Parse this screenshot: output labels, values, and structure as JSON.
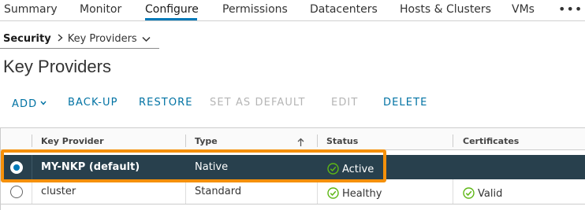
{
  "tabs": [
    {
      "label": "Summary"
    },
    {
      "label": "Monitor"
    },
    {
      "label": "Configure"
    },
    {
      "label": "Permissions"
    },
    {
      "label": "Datacenters"
    },
    {
      "label": "Hosts & Clusters"
    },
    {
      "label": "VMs"
    }
  ],
  "active_tab": "Configure",
  "more_label": "•••",
  "breadcrumb": {
    "root": "Security",
    "current": "Key Providers"
  },
  "page_title": "Key Providers",
  "toolbar": {
    "add": "ADD",
    "backup": "BACK-UP",
    "restore": "RESTORE",
    "set_default": "SET AS DEFAULT",
    "edit": "EDIT",
    "delete": "DELETE"
  },
  "grid": {
    "columns": [
      "Key Provider",
      "Type",
      "Status",
      "Certificates"
    ],
    "sorted_column": "Type",
    "sort_direction": "ascending",
    "rows": [
      {
        "key_provider": "MY-NKP (default)",
        "type": "Native",
        "status": "Active",
        "certificates": "",
        "selected": true
      },
      {
        "key_provider": "cluster",
        "type": "Standard",
        "status": "Healthy",
        "certificates": "Valid",
        "selected": false
      }
    ]
  },
  "colors": {
    "accent": "#0079b8",
    "link": "#0072a3",
    "selected_row": "#28404d",
    "status_ok": "#5eb715",
    "highlight": "#f5900a",
    "disabled": "#b5b5b5"
  },
  "icons": {
    "status": "check-circle-icon",
    "sort": "arrow-up-icon",
    "more": "ellipsis-icon",
    "dropdown": "chevron-down-icon",
    "breadcrumb_separator": "chevron-right-icon"
  }
}
